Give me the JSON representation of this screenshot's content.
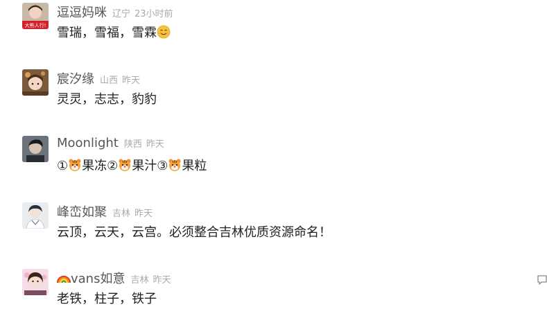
{
  "comments": [
    {
      "username": "逗逗妈咪",
      "location": "辽宁",
      "time": "23小时前",
      "avatar_badge": "大熊人行!",
      "text": "雪瑞，雪福，雪霖",
      "trailing_emoji": "smiling-face-emoji"
    },
    {
      "username": "宸汐缘",
      "location": "山西",
      "time": "昨天",
      "text": "灵灵，志志，豹豹"
    },
    {
      "username": "Moonlight",
      "location": "陕西",
      "time": "昨天",
      "segments": [
        {
          "marker": "①",
          "emoji": "tiger-face-emoji",
          "word": "果冻"
        },
        {
          "marker": "②",
          "emoji": "tiger-face-emoji",
          "word": "果汁"
        },
        {
          "marker": "③",
          "emoji": "tiger-face-emoji",
          "word": "果粒"
        }
      ]
    },
    {
      "username": "峰峦如聚",
      "location": "吉林",
      "time": "昨天",
      "text": "云顶，云天，云宫。必须整合吉林优质资源命名！"
    },
    {
      "username_prefix_emoji": "rainbow-emoji",
      "username": "vans如意",
      "location": "吉林",
      "time": "昨天",
      "text": "老铁，柱子，铁子",
      "has_reply_icon": true
    }
  ],
  "colors": {
    "username": "#555555",
    "meta": "#aaaaaa",
    "content": "#222222",
    "background": "#ffffff"
  }
}
